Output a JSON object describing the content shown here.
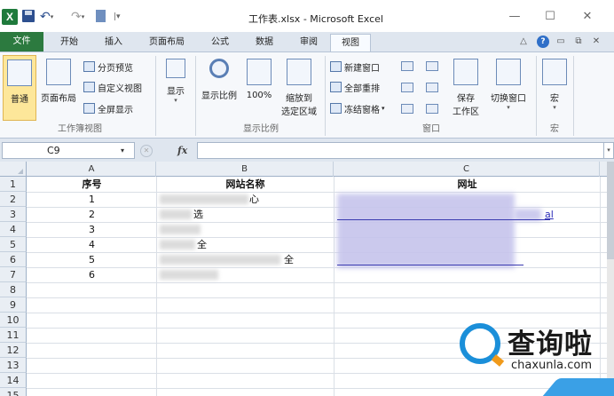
{
  "window": {
    "title": "工作表.xlsx - Microsoft Excel",
    "app_icon": "X",
    "controls": {
      "minimize": "—",
      "maximize": "☐",
      "close": "✕"
    }
  },
  "ribbon_tabs": [
    {
      "label": "文件"
    },
    {
      "label": "开始"
    },
    {
      "label": "插入"
    },
    {
      "label": "页面布局"
    },
    {
      "label": "公式"
    },
    {
      "label": "数据"
    },
    {
      "label": "审阅"
    },
    {
      "label": "视图"
    }
  ],
  "ribbon": {
    "workbook_views": {
      "label": "工作簿视图",
      "normal": "普通",
      "page_layout": "页面布局",
      "page_break_preview": "分页预览",
      "custom_views": "自定义视图",
      "full_screen": "全屏显示"
    },
    "show": {
      "label": "显示"
    },
    "zoom": {
      "label": "显示比例",
      "zoom": "显示比例",
      "hundred": "100%",
      "zoom_selection_1": "缩放到",
      "zoom_selection_2": "选定区域"
    },
    "window": {
      "label": "窗口",
      "new_window": "新建窗口",
      "arrange_all": "全部重排",
      "freeze_panes": "冻结窗格",
      "save_workspace_1": "保存",
      "save_workspace_2": "工作区",
      "switch_windows": "切换窗口"
    },
    "macros": {
      "label": "宏",
      "button": "宏"
    }
  },
  "formula_bar": {
    "name_box": "C9",
    "fx": "fx",
    "value": ""
  },
  "columns": [
    "A",
    "B",
    "C"
  ],
  "rows": [
    "1",
    "2",
    "3",
    "4",
    "5",
    "6",
    "7",
    "8",
    "9",
    "10",
    "11",
    "12",
    "13",
    "14",
    "15"
  ],
  "table": {
    "headers": [
      "序号",
      "网站名称",
      "网址"
    ],
    "serials": [
      "1",
      "2",
      "3",
      "4",
      "5",
      "6"
    ],
    "name_fragments": [
      "心",
      "选",
      "全",
      "全"
    ],
    "url_fragment": "al"
  },
  "watermark": {
    "brand": "查询啦",
    "url": "chaxunla.com"
  },
  "colors": {
    "file_tab": "#2c7a3f",
    "excel_green": "#1f7a3c",
    "link": "#2b2bb8",
    "watermark_blue": "#1b8fd9"
  }
}
